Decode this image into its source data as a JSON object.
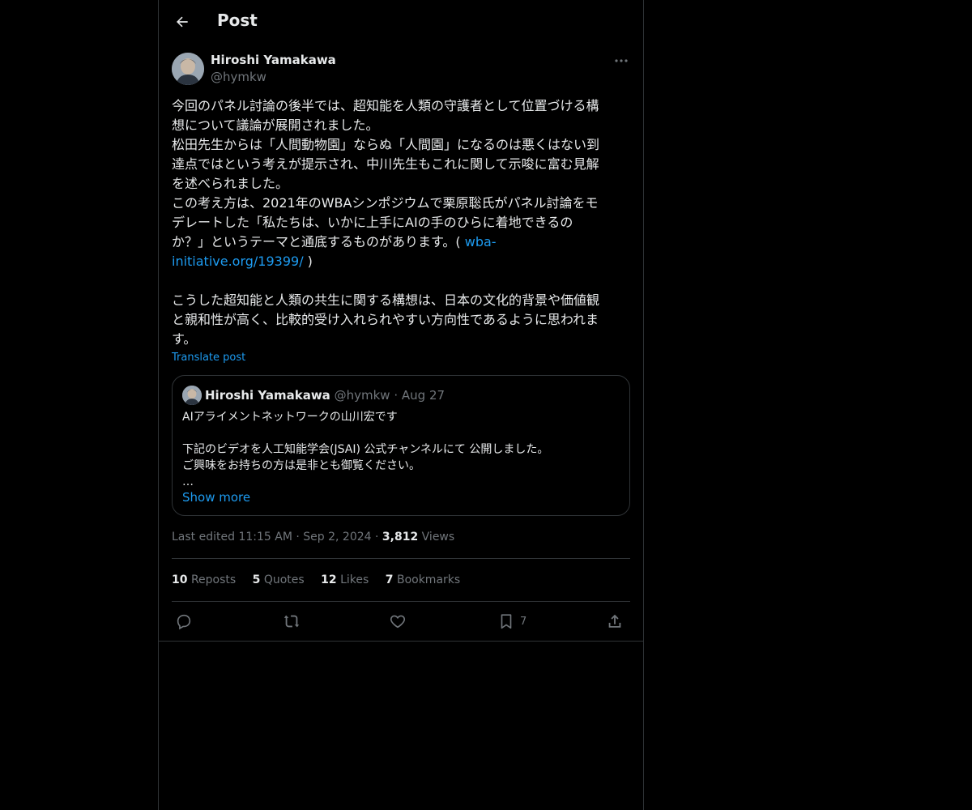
{
  "header": {
    "title": "Post",
    "back_icon": "arrow-left-icon"
  },
  "author": {
    "name": "Hiroshi Yamakawa",
    "handle": "@hymkw"
  },
  "post": {
    "text_parts": [
      "今回のパネル討論の後半では、超知能を人類の守護者として位置づける構\n想について議論が展開されました。\n松田先生からは「人間動物園」ならぬ「人間園」になるのは悪くはない到\n達点ではという考えが提示され、中川先生もこれに関して示唆に富む見解\nを述べられました。\nこの考え方は、2021年のWBAシンポジウムで栗原聡氏がパネル討論をモ\nデレートした「私たちは、いかに上手にAIの手のひらに着地できるの\nか？」というテーマと通底するものがあります。( ",
      "wba-\ninitiative.org/19399/",
      " )\n\nこうした超知能と人類の共生に関する構想は、日本の文化的背景や価値観\nと親和性が高く、比較的受け入れられやすい方向性であるように思われま\nす。"
    ],
    "translate_label": "Translate post"
  },
  "quote": {
    "name": "Hiroshi Yamakawa",
    "handle": "@hymkw",
    "separator": "·",
    "date": "Aug 27",
    "text": "AIアライメントネットワークの山川宏です\n\n下記のビデオを人工知能学会(JSAI) 公式チャンネルにて 公開しました。\nご興味をお持ちの方は是非とも御覧ください。\n…",
    "show_more": "Show more"
  },
  "meta": {
    "edited": "Last edited 11:15 AM",
    "sep": "·",
    "date": "Sep 2, 2024",
    "views_count": "3,812",
    "views_label": "Views"
  },
  "stats": {
    "reposts": {
      "count": "10",
      "label": "Reposts"
    },
    "quotes": {
      "count": "5",
      "label": "Quotes"
    },
    "likes": {
      "count": "12",
      "label": "Likes"
    },
    "bookmarks": {
      "count": "7",
      "label": "Bookmarks"
    }
  },
  "actions": {
    "reply_icon": "reply-icon",
    "repost_icon": "repost-icon",
    "like_icon": "heart-icon",
    "bookmark_icon": "bookmark-icon",
    "bookmark_count": "7",
    "share_icon": "share-icon"
  },
  "colors": {
    "background": "#000000",
    "text": "#e7e9ea",
    "muted": "#71767b",
    "accent": "#1d9bf0",
    "border": "#2f3336"
  }
}
